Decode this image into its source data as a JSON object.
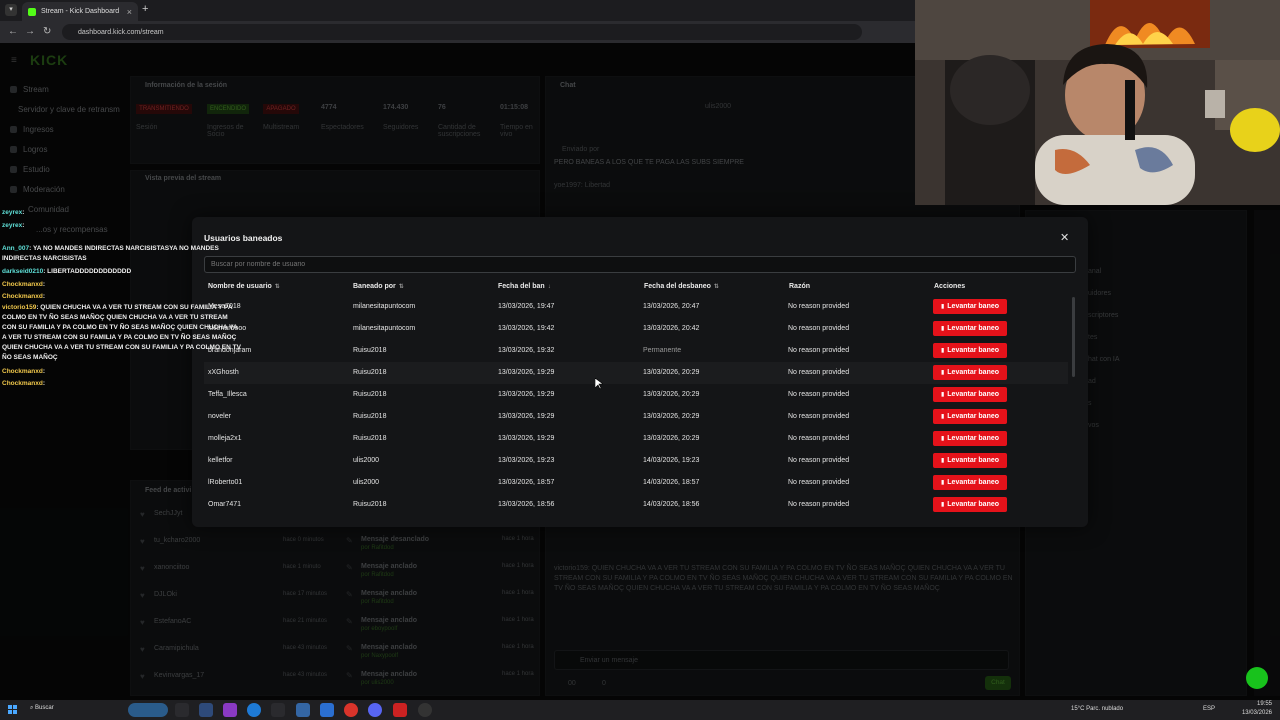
{
  "browser": {
    "tab_title": "Stream - Kick Dashboard",
    "url": "dashboard.kick.com/stream"
  },
  "dashboard": {
    "logo": "KICK",
    "sidebar": [
      {
        "label": "Stream"
      },
      {
        "label": "Servidor y clave de retransm"
      },
      {
        "label": "Ingresos"
      },
      {
        "label": "Logros"
      },
      {
        "label": "Estudio"
      },
      {
        "label": "Moderación"
      },
      {
        "label": "Comunidad"
      },
      {
        "label": "...os y recompensas"
      }
    ],
    "session_panel_title": "Información de la sesión",
    "session_badges": [
      "TRANSMITIENDO",
      "ENCENDIDO",
      "APAGADO"
    ],
    "session_badge_labels": [
      "Sesión",
      "Ingresos de Socio",
      "Multistream"
    ],
    "session_stats": [
      {
        "value": "4774",
        "label": "Espectadores"
      },
      {
        "value": "174.430",
        "label": "Seguidores"
      },
      {
        "value": "76",
        "label": "Cantidad de suscripciones"
      },
      {
        "value": "01:15:08",
        "label": "Tiempo en vivo"
      }
    ],
    "preview_title": "Vista previa del stream",
    "chat_title": "Chat",
    "feed_title": "Feed de activi",
    "feed_items": [
      {
        "name": "SechJJyt",
        "time": ""
      },
      {
        "name": "tu_kcharo2000",
        "time": "hace 0 minutos"
      },
      {
        "name": "xanonciitoo",
        "time": "hace 1 minuto"
      },
      {
        "name": "DJLOki",
        "time": "hace 17 minutos"
      },
      {
        "name": "EstefanoAC",
        "time": "hace 21 minutos"
      },
      {
        "name": "Caramipichula",
        "time": "hace 43 minutos"
      },
      {
        "name": "Kevinvargas_17",
        "time": "hace 43 minutos"
      }
    ],
    "mod_actions": [
      {
        "label": "Mensaje desanclado",
        "by": "por Rafitdod",
        "time": "hace 1 hora"
      },
      {
        "label": "Mensaje anclado",
        "by": "por Rafitdod",
        "time": "hace 1 hora"
      },
      {
        "label": "Mensaje anclado",
        "by": "por Rafitdod",
        "time": "hace 1 hora"
      },
      {
        "label": "Mensaje anclado",
        "by": "por eboypoolf",
        "time": "hace 1 hora"
      },
      {
        "label": "Mensaje anclado",
        "by": "por Naxypoolf",
        "time": "hace 1 hora"
      },
      {
        "label": "Mensaje anclado",
        "by": "por ulis2000",
        "time": "hace 1 hora"
      }
    ],
    "chat_pinned": "PERO BANEAS A LOS QUE TE PAGA LAS SUBS SIEMPRE",
    "chat_pinned_by": "Enviado por",
    "chat_user_top": "ulis2000",
    "chat_line_small": "yoe1997: Libertad",
    "chat_input_placeholder": "Enviar un mensaje",
    "chat_send": "Chat",
    "chat_counts": [
      "00",
      "0"
    ],
    "chat_bottom_msg": "victorio159: QUIEN CHUCHA VA A VER TU STREAM CON SU FAMILIA Y PA COLMO EN TV ÑO SEAS MAÑOÇ QUIEN CHUCHA VA A VER TU STREAM CON SU FAMILIA Y PA COLMO EN TV ÑO SEAS MAÑOÇ QUIEN CHUCHA VA A VER TU STREAM CON SU FAMILIA Y PA COLMO EN TV ÑO SEAS MAÑOÇ QUIEN CHUCHA VA A VER TU STREAM CON SU FAMILIA Y PA COLMO EN TV ÑO SEAS MAÑOÇ",
    "right_panel_items": [
      "anal",
      "uidores",
      "scriptores",
      "tes",
      "hat con IA",
      "ad",
      "s",
      "vos"
    ]
  },
  "chat_overlay": [
    {
      "user": "zeyrex",
      "text": ":"
    },
    {
      "user": "zeyrex",
      "text": ":"
    },
    {
      "user": "Ann_007",
      "text": ": YA NO MANDES INDIRECTAS NARCISISTASYA NO MANDES INDIRECTAS NARCISISTAS"
    },
    {
      "user": "darkseid0210",
      "text": ": LIBERTADDDDDDDDDDDD"
    },
    {
      "user": "Chockmanxd",
      "text": ":"
    },
    {
      "user": "Chockmanxd",
      "text": ":"
    },
    {
      "user": "victorio159",
      "text": ": QUIEN CHUCHA VA A VER TU STREAM CON SU FAMILIA Y PA COLMO EN TV ÑO SEAS MAÑOÇ QUIEN CHUCHA VA A VER TU STREAM CON SU FAMILIA Y PA COLMO EN TV ÑO SEAS MAÑOÇ QUIEN CHUCHA VA A VER TU STREAM CON SU FAMILIA Y PA COLMO EN TV ÑO SEAS MAÑOÇ QUIEN CHUCHA VA A VER TU STREAM CON SU FAMILIA Y PA COLMO EN TV ÑO SEAS MAÑOÇ"
    },
    {
      "user": "Chockmanxd",
      "text": ":"
    },
    {
      "user": "Chockmanxd",
      "text": ":"
    }
  ],
  "modal": {
    "title": "Usuarios baneados",
    "search_placeholder": "Buscar por nombre de usuario",
    "columns": [
      "Nombre de usuario",
      "Baneado por",
      "Fecha del ban",
      "Fecha del desbaneo",
      "Razón",
      "Acciones"
    ],
    "unban_label": "Levantar baneo",
    "rows": [
      {
        "user": "Mesa7018",
        "by": "milanesitapuntocom",
        "ban": "13/03/2026, 19:47",
        "unban": "13/03/2026, 20:47",
        "reason": "No reason provided"
      },
      {
        "user": "xxlenarbooo",
        "by": "milanesitapuntocom",
        "ban": "13/03/2026, 19:42",
        "unban": "13/03/2026, 20:42",
        "reason": "No reason provided"
      },
      {
        "user": "brandonjaram",
        "by": "Ruisu2018",
        "ban": "13/03/2026, 19:32",
        "unban": "Permanente",
        "reason": "No reason provided"
      },
      {
        "user": "xXGhosth",
        "by": "Ruisu2018",
        "ban": "13/03/2026, 19:29",
        "unban": "13/03/2026, 20:29",
        "reason": "No reason provided"
      },
      {
        "user": "Teffa_Illesca",
        "by": "Ruisu2018",
        "ban": "13/03/2026, 19:29",
        "unban": "13/03/2026, 20:29",
        "reason": "No reason provided"
      },
      {
        "user": "noveler",
        "by": "Ruisu2018",
        "ban": "13/03/2026, 19:29",
        "unban": "13/03/2026, 20:29",
        "reason": "No reason provided"
      },
      {
        "user": "molleja2x1",
        "by": "Ruisu2018",
        "ban": "13/03/2026, 19:29",
        "unban": "13/03/2026, 20:29",
        "reason": "No reason provided"
      },
      {
        "user": "kelletfor",
        "by": "ulis2000",
        "ban": "13/03/2026, 19:23",
        "unban": "14/03/2026, 19:23",
        "reason": "No reason provided"
      },
      {
        "user": "lRoberto01",
        "by": "ulis2000",
        "ban": "13/03/2026, 18:57",
        "unban": "14/03/2026, 18:57",
        "reason": "No reason provided"
      },
      {
        "user": "Omar7471",
        "by": "Ruisu2018",
        "ban": "13/03/2026, 18:56",
        "unban": "14/03/2026, 18:56",
        "reason": "No reason provided"
      }
    ]
  },
  "taskbar": {
    "search": "Buscar",
    "weather": "15°C Parc. nublado",
    "lang": "ESP",
    "time": "19:55",
    "date": "13/03/2026"
  },
  "colors": {
    "accent_red": "#e5121a",
    "kick_green": "#53fc18"
  }
}
